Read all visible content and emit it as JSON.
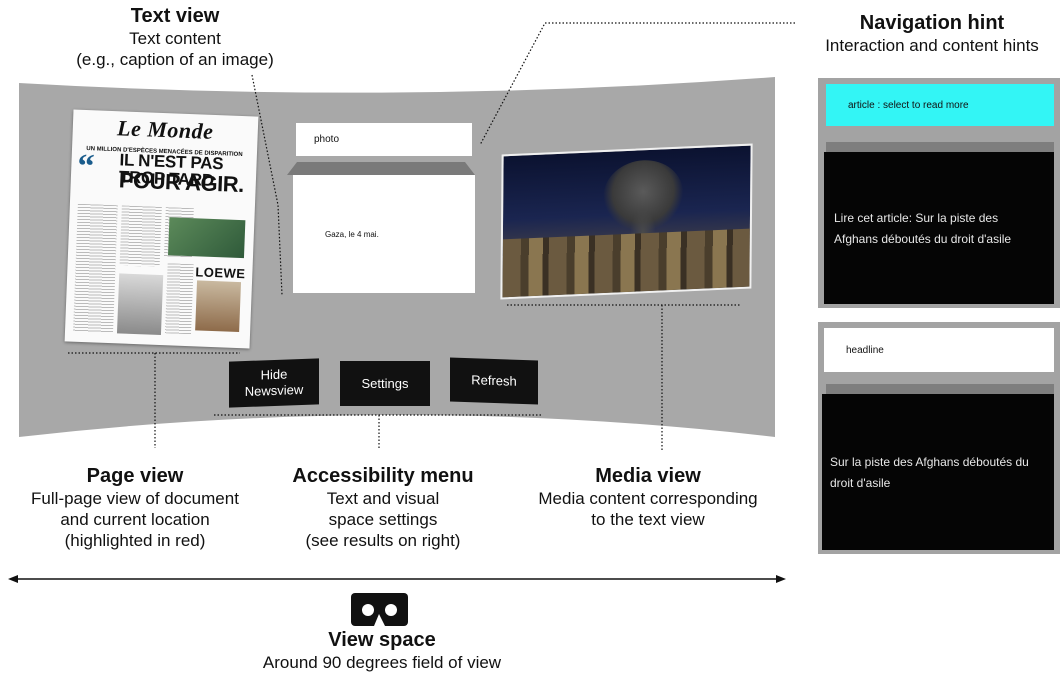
{
  "callouts": {
    "text_view": {
      "title": "Text view",
      "line1": "Text content",
      "line2": "(e.g., caption of an image)"
    },
    "navigation_hint": {
      "title": "Navigation hint",
      "line1": "Interaction and content hints"
    },
    "page_view": {
      "title": "Page view",
      "line1": "Full-page view of document",
      "line2": "and current location",
      "line3": "(highlighted in red)"
    },
    "accessibility_menu": {
      "title": "Accessibility menu",
      "line1": "Text and visual",
      "line2": "space settings",
      "line3": "(see results on right)"
    },
    "media_view": {
      "title": "Media view",
      "line1": "Media content corresponding",
      "line2": "to the text view"
    },
    "view_space": {
      "title": "View space",
      "line1": "Around 90 degrees field of view"
    }
  },
  "vr_scene": {
    "photo_label": "photo",
    "caption_text": "Gaza, le 4 mai.",
    "buttons": {
      "hide": "Hide Newsview",
      "settings": "Settings",
      "refresh": "Refresh"
    }
  },
  "newspaper": {
    "masthead": "Le Monde",
    "kicker": "UN MILLION D'ESPÈCES MENACÉES DE DISPARITION",
    "headline_line1": "IL N'EST PAS TROP TARD",
    "headline_line2": "POUR AGIR.",
    "brand": "LOEWE"
  },
  "side_panels": {
    "top": {
      "hint": "article : select to read more",
      "body": "Lire cet article: Sur la piste des Afghans déboutés du droit d'asile"
    },
    "bottom": {
      "hint": "headline",
      "body": "Sur la piste des Afghans déboutés du droit d'asile"
    }
  },
  "colors": {
    "hint_highlight": "#33f5f5",
    "scene_gray": "#a8a8a8",
    "dark_panel": "#050505"
  },
  "icons": {
    "view_space": "vr-headset-icon"
  }
}
